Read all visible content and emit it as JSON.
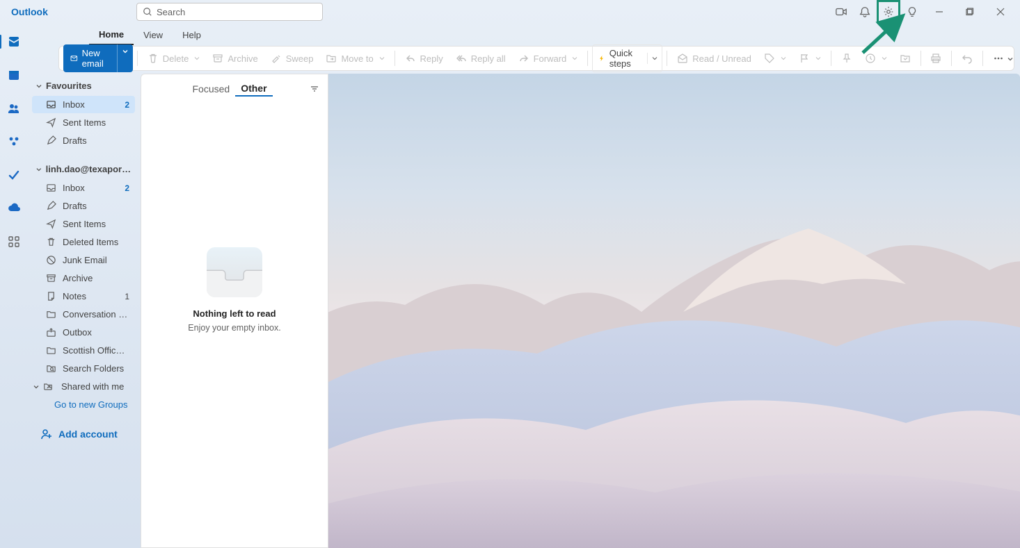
{
  "app": {
    "name": "Outlook"
  },
  "search": {
    "placeholder": "Search"
  },
  "tabs": {
    "home": "Home",
    "view": "View",
    "help": "Help"
  },
  "toolbar": {
    "new_email": "New email",
    "delete": "Delete",
    "archive": "Archive",
    "sweep": "Sweep",
    "move_to": "Move to",
    "reply": "Reply",
    "reply_all": "Reply all",
    "forward": "Forward",
    "quick_steps": "Quick steps",
    "read_unread": "Read / Unread"
  },
  "nav": {
    "favourites": "Favourites",
    "account": "linh.dao@texaport....",
    "fav_items": [
      {
        "label": "Inbox",
        "badge": "2"
      },
      {
        "label": "Sent Items",
        "badge": ""
      },
      {
        "label": "Drafts",
        "badge": ""
      }
    ],
    "acct_items": [
      {
        "label": "Inbox",
        "badge": "2"
      },
      {
        "label": "Drafts",
        "badge": ""
      },
      {
        "label": "Sent Items",
        "badge": ""
      },
      {
        "label": "Deleted Items",
        "badge": ""
      },
      {
        "label": "Junk Email",
        "badge": ""
      },
      {
        "label": "Archive",
        "badge": ""
      },
      {
        "label": "Notes",
        "badge": "1"
      },
      {
        "label": "Conversation Histo...",
        "badge": ""
      },
      {
        "label": "Outbox",
        "badge": ""
      },
      {
        "label": "Scottish Office em...",
        "badge": ""
      },
      {
        "label": "Search Folders",
        "badge": ""
      },
      {
        "label": "Shared with me",
        "badge": ""
      }
    ],
    "groups_link": "Go to new Groups",
    "add_account": "Add account"
  },
  "msglist": {
    "focused": "Focused",
    "other": "Other",
    "empty_title": "Nothing left to read",
    "empty_sub": "Enjoy your empty inbox."
  }
}
